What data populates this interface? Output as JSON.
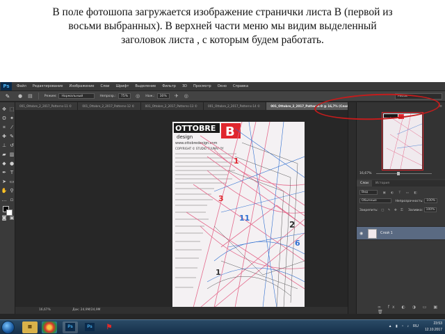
{
  "caption": {
    "line1": "В поле фотошопа загружается изображение странички листа В (первой из",
    "line2": "восьми выбранных). В верхней части меню мы видим выделенный",
    "line3": "заголовок  листа , с которым будем работать."
  },
  "photoshop": {
    "logo": "Ps",
    "menu": [
      "Файл",
      "Редактирование",
      "Изображение",
      "Слои",
      "Шрифт",
      "Выделение",
      "Фильтр",
      "3D",
      "Просмотр",
      "Окно",
      "Справка"
    ],
    "options": {
      "mode_label": "Режим:",
      "mode_value": "Нормальный",
      "opacity_label": "Непрозр.:",
      "opacity_value": "75%",
      "flow_label": "Наж.:",
      "flow_value": "30%",
      "workspace": "Рисов"
    },
    "tabs": [
      "001_Ottobre_2_2017_Patterns-11 ©",
      "001_Ottobre_2_2017_Patterns-12 ©",
      "001_Ottobre_2_2017_Patterns-13 ©",
      "001_Ottobre_2_2017_Patterns-14 ©"
    ],
    "active_tab": "001_Ottobre_2_2017_Patterns-9 @ 16,7% (Слой 1, RGB/8) *",
    "document": {
      "brand": "OTTOBRE",
      "brand_sub": "design",
      "sheet_letter": "B",
      "website": "www.ottobredesign.com",
      "copyright": "COPYRIGHT © STUDIO TUUMAT OY",
      "numbers": [
        "1",
        "3",
        "11",
        "2",
        "6",
        "1"
      ]
    },
    "status": {
      "zoom": "16,67%",
      "doc_size": "Док: 24,9M/24,9M"
    },
    "navigator": {
      "zoom": "16,67%"
    },
    "layers_panel": {
      "tabs": [
        "Слои",
        "История"
      ],
      "kind": "Вид",
      "blend_mode": "Обычные",
      "opacity_label": "Непрозрачность:",
      "opacity_value": "100%",
      "lock_label": "Закрепить:",
      "fill_label": "Заливка:",
      "fill_value": "100%",
      "layer_name": "Слой 1"
    }
  },
  "taskbar": {
    "apps": [
      "Ps",
      "Ps"
    ],
    "time": "23:53",
    "date": "12.10.2017",
    "lang": "RU"
  },
  "colors": {
    "highlight": "#c41c1c",
    "accent_red": "#e0262e",
    "pattern_pink": "#e46a8c",
    "pattern_blue": "#2f6fd0"
  }
}
